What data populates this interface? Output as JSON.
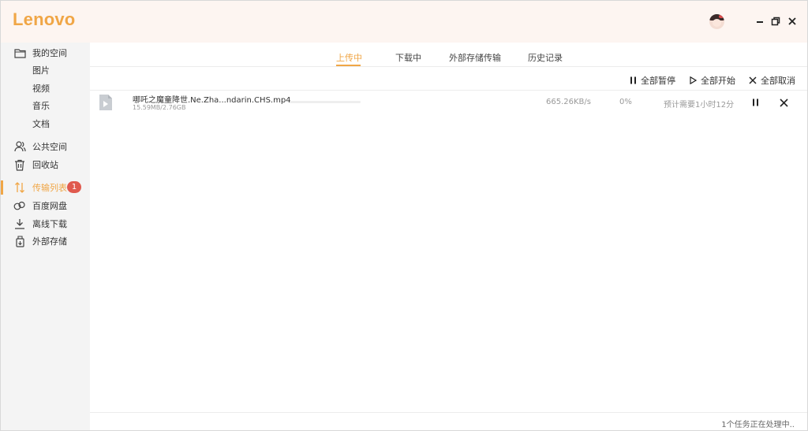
{
  "app": {
    "logo_text": "Lenovo"
  },
  "sidebar": {
    "items": [
      {
        "label": "我的空间",
        "icon": "folder-icon"
      },
      {
        "label": "图片",
        "icon": ""
      },
      {
        "label": "视频",
        "icon": ""
      },
      {
        "label": "音乐",
        "icon": ""
      },
      {
        "label": "文档",
        "icon": ""
      },
      {
        "label": "公共空间",
        "icon": "users-icon"
      },
      {
        "label": "回收站",
        "icon": "trash-icon"
      },
      {
        "label": "传输列表",
        "icon": "transfer-icon",
        "active": true,
        "badge": "1"
      },
      {
        "label": "百度网盘",
        "icon": "baidu-cloud-icon"
      },
      {
        "label": "离线下载",
        "icon": "download-icon"
      },
      {
        "label": "外部存储",
        "icon": "external-storage-icon"
      }
    ]
  },
  "tabs": [
    {
      "label": "上传中",
      "active": true
    },
    {
      "label": "下载中",
      "active": false
    },
    {
      "label": "外部存储传输",
      "active": false
    },
    {
      "label": "历史记录",
      "active": false
    }
  ],
  "toolbar": {
    "pause_all": "全部暂停",
    "start_all": "全部开始",
    "cancel_all": "全部取消"
  },
  "transfers": [
    {
      "file_name": "哪吒之魔童降世.Ne.Zha...ndarin.CHS.mp4",
      "size": "15.59MB/2.76GB",
      "speed": "665.26KB/s",
      "percent": "0%",
      "progress": 0.0,
      "eta": "预计需要1小时12分"
    }
  ],
  "status": {
    "text": "1个任务正在处理中.."
  },
  "colors": {
    "accent": "#f0a646",
    "badge": "#e05a4e",
    "sidebar_bg": "#f4f4f4",
    "titlebar_bg": "#fdf5f1"
  }
}
